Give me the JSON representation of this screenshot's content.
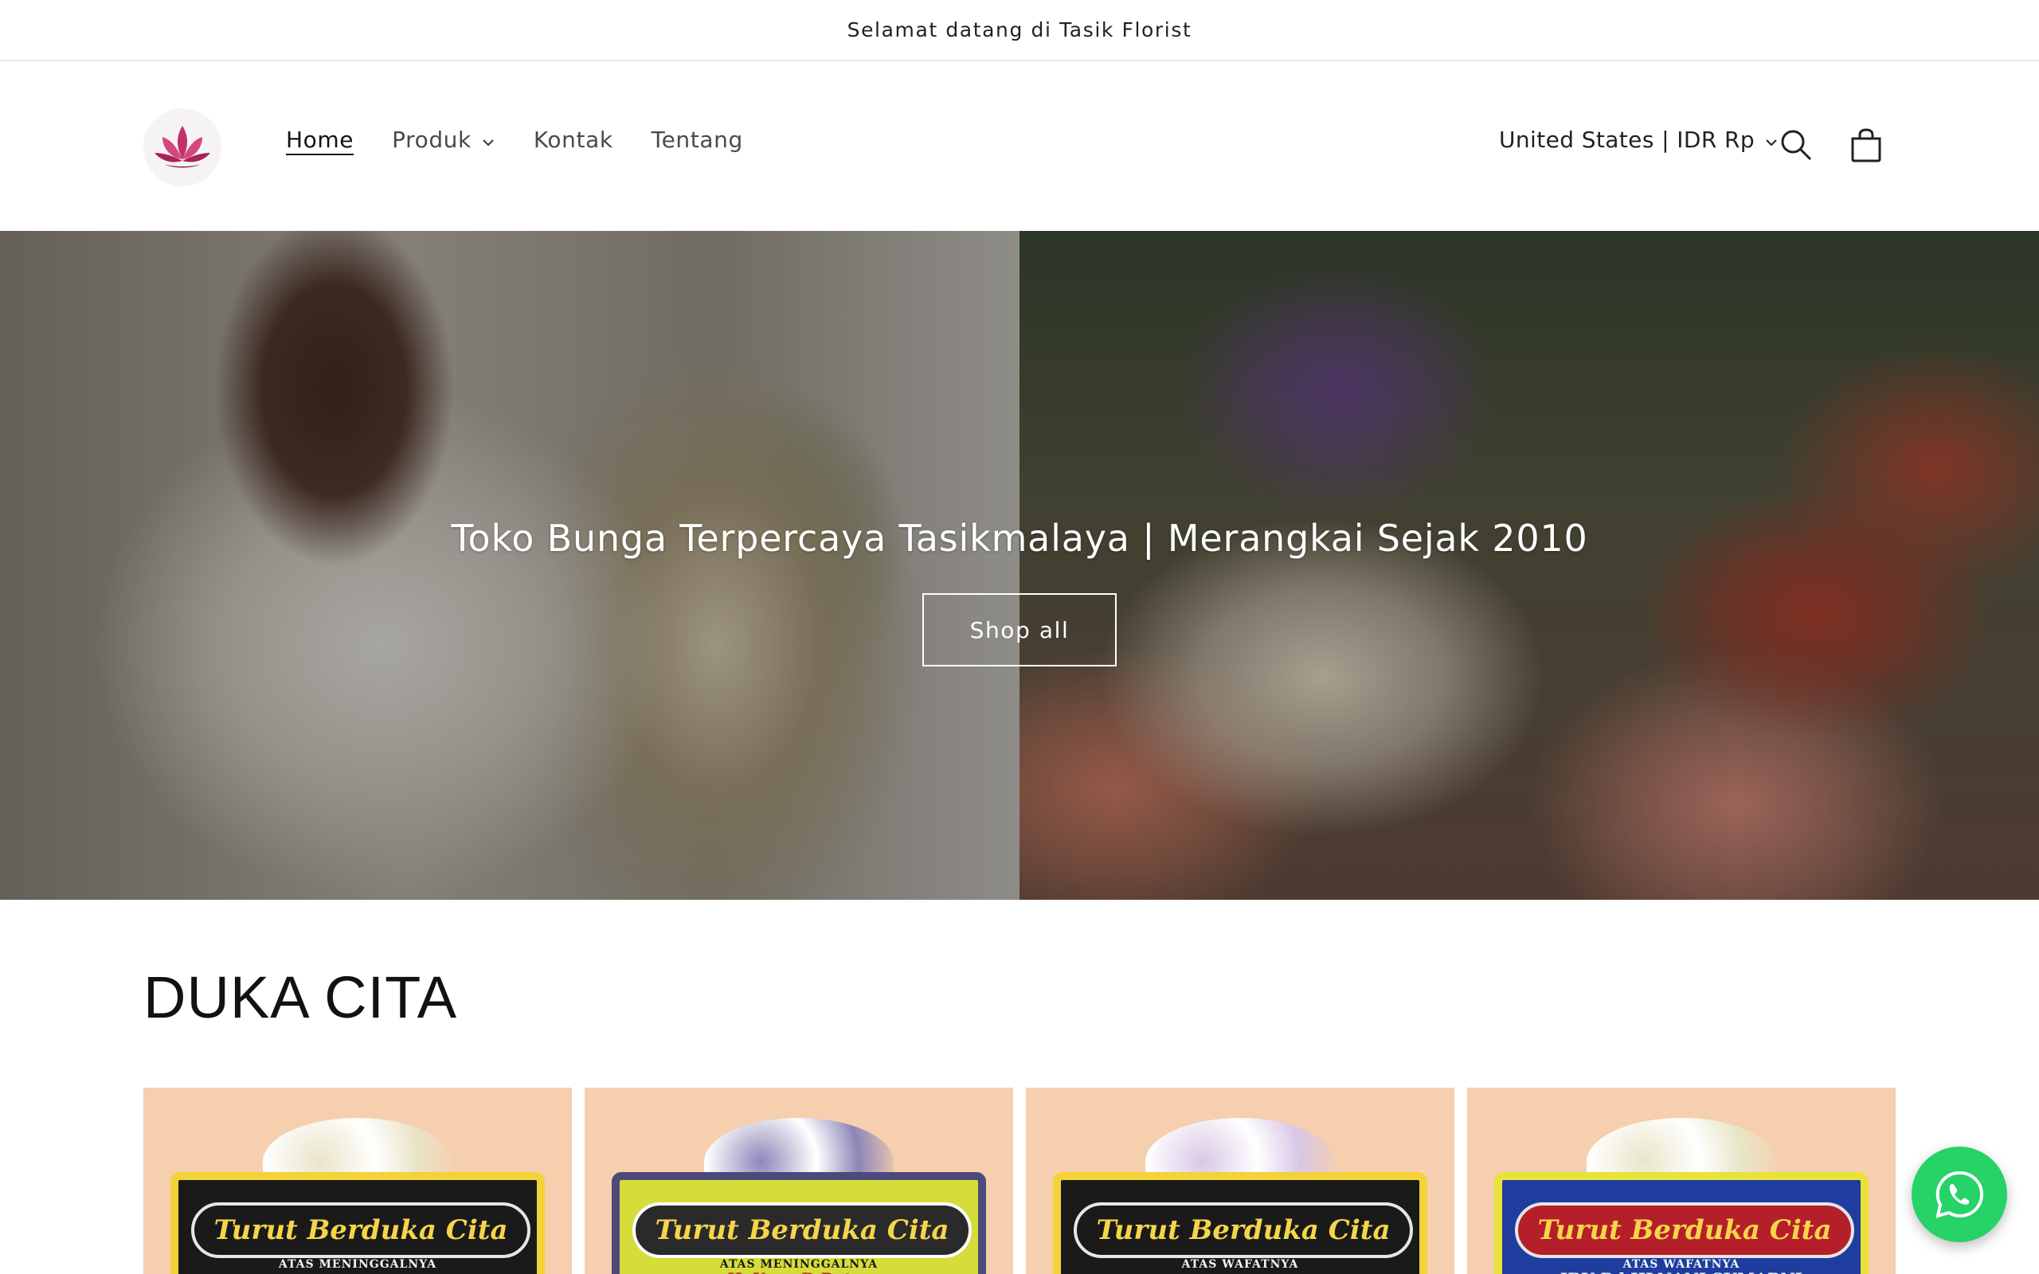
{
  "announcement": {
    "text": "Selamat datang di Tasik Florist"
  },
  "header": {
    "logo_icon": "lotus-icon",
    "nav": [
      {
        "label": "Home",
        "active": true
      },
      {
        "label": "Produk",
        "has_dropdown": true
      },
      {
        "label": "Kontak"
      },
      {
        "label": "Tentang"
      }
    ],
    "locale": "United States | IDR Rp",
    "search_icon": "search-icon",
    "cart_icon": "cart-icon"
  },
  "hero": {
    "title": "Toko Bunga Terpercaya Tasikmalaya | Merangkai Sejak 2010",
    "button_label": "Shop all"
  },
  "section": {
    "title": "DUKA CITA",
    "products": [
      {
        "banner": "Turut Berduka Cita",
        "subtitle": "ATAS MENINGGALNYA",
        "name": "",
        "board_color": "#1a1a1a",
        "frame_color": "#f3d23a",
        "flower_color": "#e9e4c8"
      },
      {
        "banner": "Turut Berduka Cita",
        "subtitle": "ATAS MENINGGALNYA",
        "name": "H. Yana D Putra",
        "board_color": "#d6dc3a",
        "frame_color": "#4b4a7a",
        "flower_color": "#8c86b8"
      },
      {
        "banner": "Turut Berduka Cita",
        "subtitle": "ATAS WAFATNYA",
        "name": "",
        "board_color": "#1a1a1a",
        "frame_color": "#f3d23a",
        "flower_color": "#d8c7e6"
      },
      {
        "banner": "Turut Berduka Cita",
        "subtitle": "ATAS WAFATNYA",
        "name": "IBU Rd.HJ.NANI SUMARNI",
        "board_color": "#1f3d9e",
        "frame_color": "#e8e23a",
        "flower_color": "#e8e6c8"
      }
    ]
  },
  "whatsapp_icon": "whatsapp-icon",
  "colors": {
    "accent": "#121212",
    "whatsapp": "#25d366",
    "card_bg": "#f6cfae"
  }
}
